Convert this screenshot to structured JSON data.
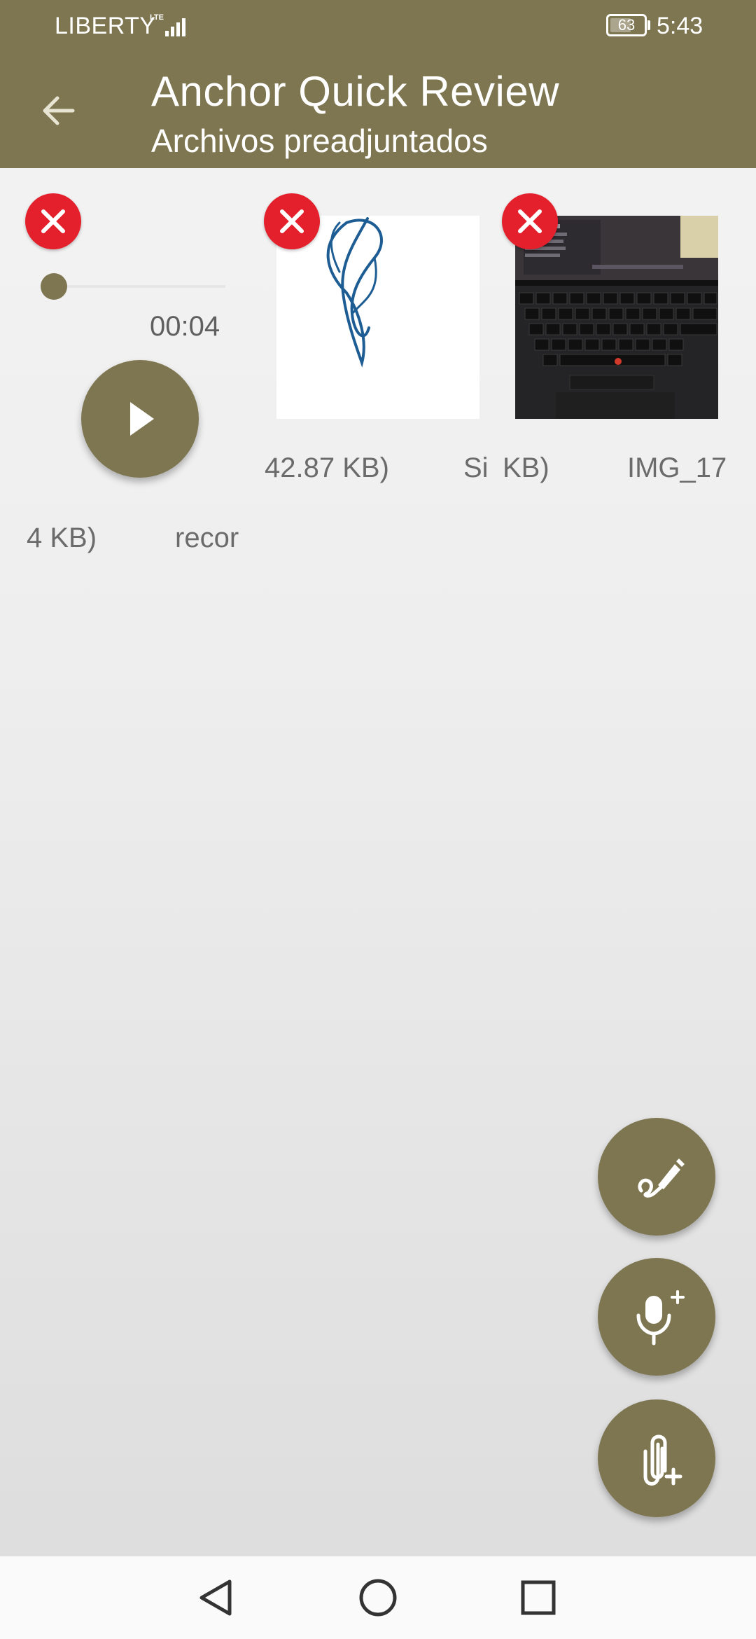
{
  "status_bar": {
    "carrier": "LIBERTY",
    "network": "LTE",
    "battery": "63",
    "battery_level": 0.63,
    "time": "5:43"
  },
  "app_bar": {
    "back_icon": "arrow-left-icon",
    "title": "Anchor Quick Review",
    "subtitle": "Archivos preadjuntados"
  },
  "attachments": {
    "audio": {
      "remove_icon": "close-icon",
      "elapsed": "00:04",
      "progress": 0.0,
      "play_icon": "play-icon"
    },
    "signature": {
      "remove_icon": "close-icon",
      "caption_fragments": [
        "42.87 KB)",
        "Si",
        "KB)"
      ]
    },
    "photo": {
      "remove_icon": "close-icon",
      "caption_fragment": "IMG_17"
    },
    "audio_captions": [
      "4 KB)",
      "recor"
    ]
  },
  "fabs": [
    {
      "name": "add-signature",
      "icon": "signature-pen-icon"
    },
    {
      "name": "add-recording",
      "icon": "microphone-plus-icon"
    },
    {
      "name": "add-attachment",
      "icon": "paperclip-plus-icon"
    }
  ],
  "nav_bar": {
    "back_icon": "triangle-back-icon",
    "home_icon": "circle-home-icon",
    "recents_icon": "square-recents-icon"
  },
  "colors": {
    "primary": "#7e7650",
    "remove": "#e3202c",
    "background": "#eeeeee"
  }
}
